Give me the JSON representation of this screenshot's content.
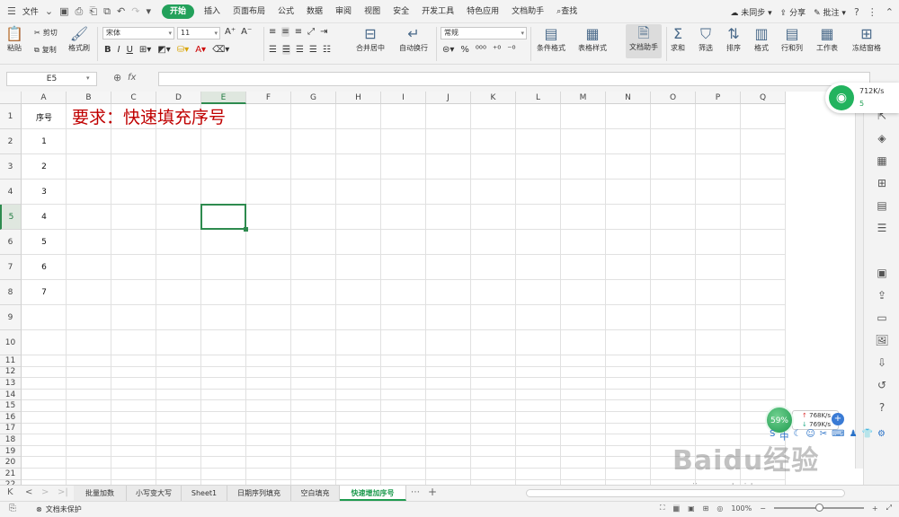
{
  "menubar": {
    "file_label": "文件",
    "tabs": [
      "开始",
      "插入",
      "页面布局",
      "公式",
      "数据",
      "审阅",
      "视图",
      "安全",
      "开发工具",
      "特色应用",
      "文档助手"
    ],
    "active_tab_index": 0,
    "search_label": "查找",
    "sync_label": "未同步",
    "share_label": "分享",
    "comment_label": "批注"
  },
  "ribbon": {
    "paste": "粘贴",
    "cut": "剪切",
    "copy": "复制",
    "format_painter": "格式刷",
    "font_name": "宋体",
    "font_size": "11",
    "merge_center": "合并居中",
    "wrap_text": "自动换行",
    "number_format": "常规",
    "conditional_format": "条件格式",
    "table_style": "表格样式",
    "doc_assistant": "文档助手",
    "sum": "求和",
    "filter": "筛选",
    "sort": "排序",
    "format": "格式",
    "row_col": "行和列",
    "worksheet": "工作表",
    "freeze": "冻结窗格"
  },
  "formula_bar": {
    "name_box": "E5",
    "fx_label": "fx",
    "formula": ""
  },
  "grid": {
    "columns": [
      "A",
      "B",
      "C",
      "D",
      "E",
      "F",
      "G",
      "H",
      "I",
      "J",
      "K",
      "L",
      "M",
      "N",
      "O",
      "P",
      "Q"
    ],
    "selected_column": "E",
    "rows": [
      "1",
      "2",
      "3",
      "4",
      "5",
      "6",
      "7",
      "8",
      "9",
      "10",
      "11",
      "12",
      "13",
      "14",
      "15",
      "16",
      "17",
      "18",
      "19",
      "20",
      "21",
      "22"
    ],
    "selected_row": "5",
    "a1_header": "序号",
    "b1_title": "要求：快速填充序号",
    "sequence": [
      "1",
      "2",
      "3",
      "4",
      "5",
      "6",
      "7"
    ],
    "active_cell": "E5"
  },
  "overlays": {
    "net_speed": "712K/s",
    "net_count": "5",
    "cpu_percent": "59%",
    "upload": "768K/s",
    "download": "769K/s"
  },
  "sheet_tabs": [
    "批量加数",
    "小写变大写",
    "Sheet1",
    "日期序列填充",
    "空白填充",
    "快速增加序号"
  ],
  "active_sheet_index": 5,
  "statusbar": {
    "protect_label": "文档未保护",
    "zoom": "100%"
  },
  "watermark": {
    "logo": "Baidu经验",
    "url": "jingyan.baidu.com"
  },
  "colors": {
    "accent": "#23a15b",
    "title_red": "#c00000",
    "selection": "#2e8b4f"
  }
}
